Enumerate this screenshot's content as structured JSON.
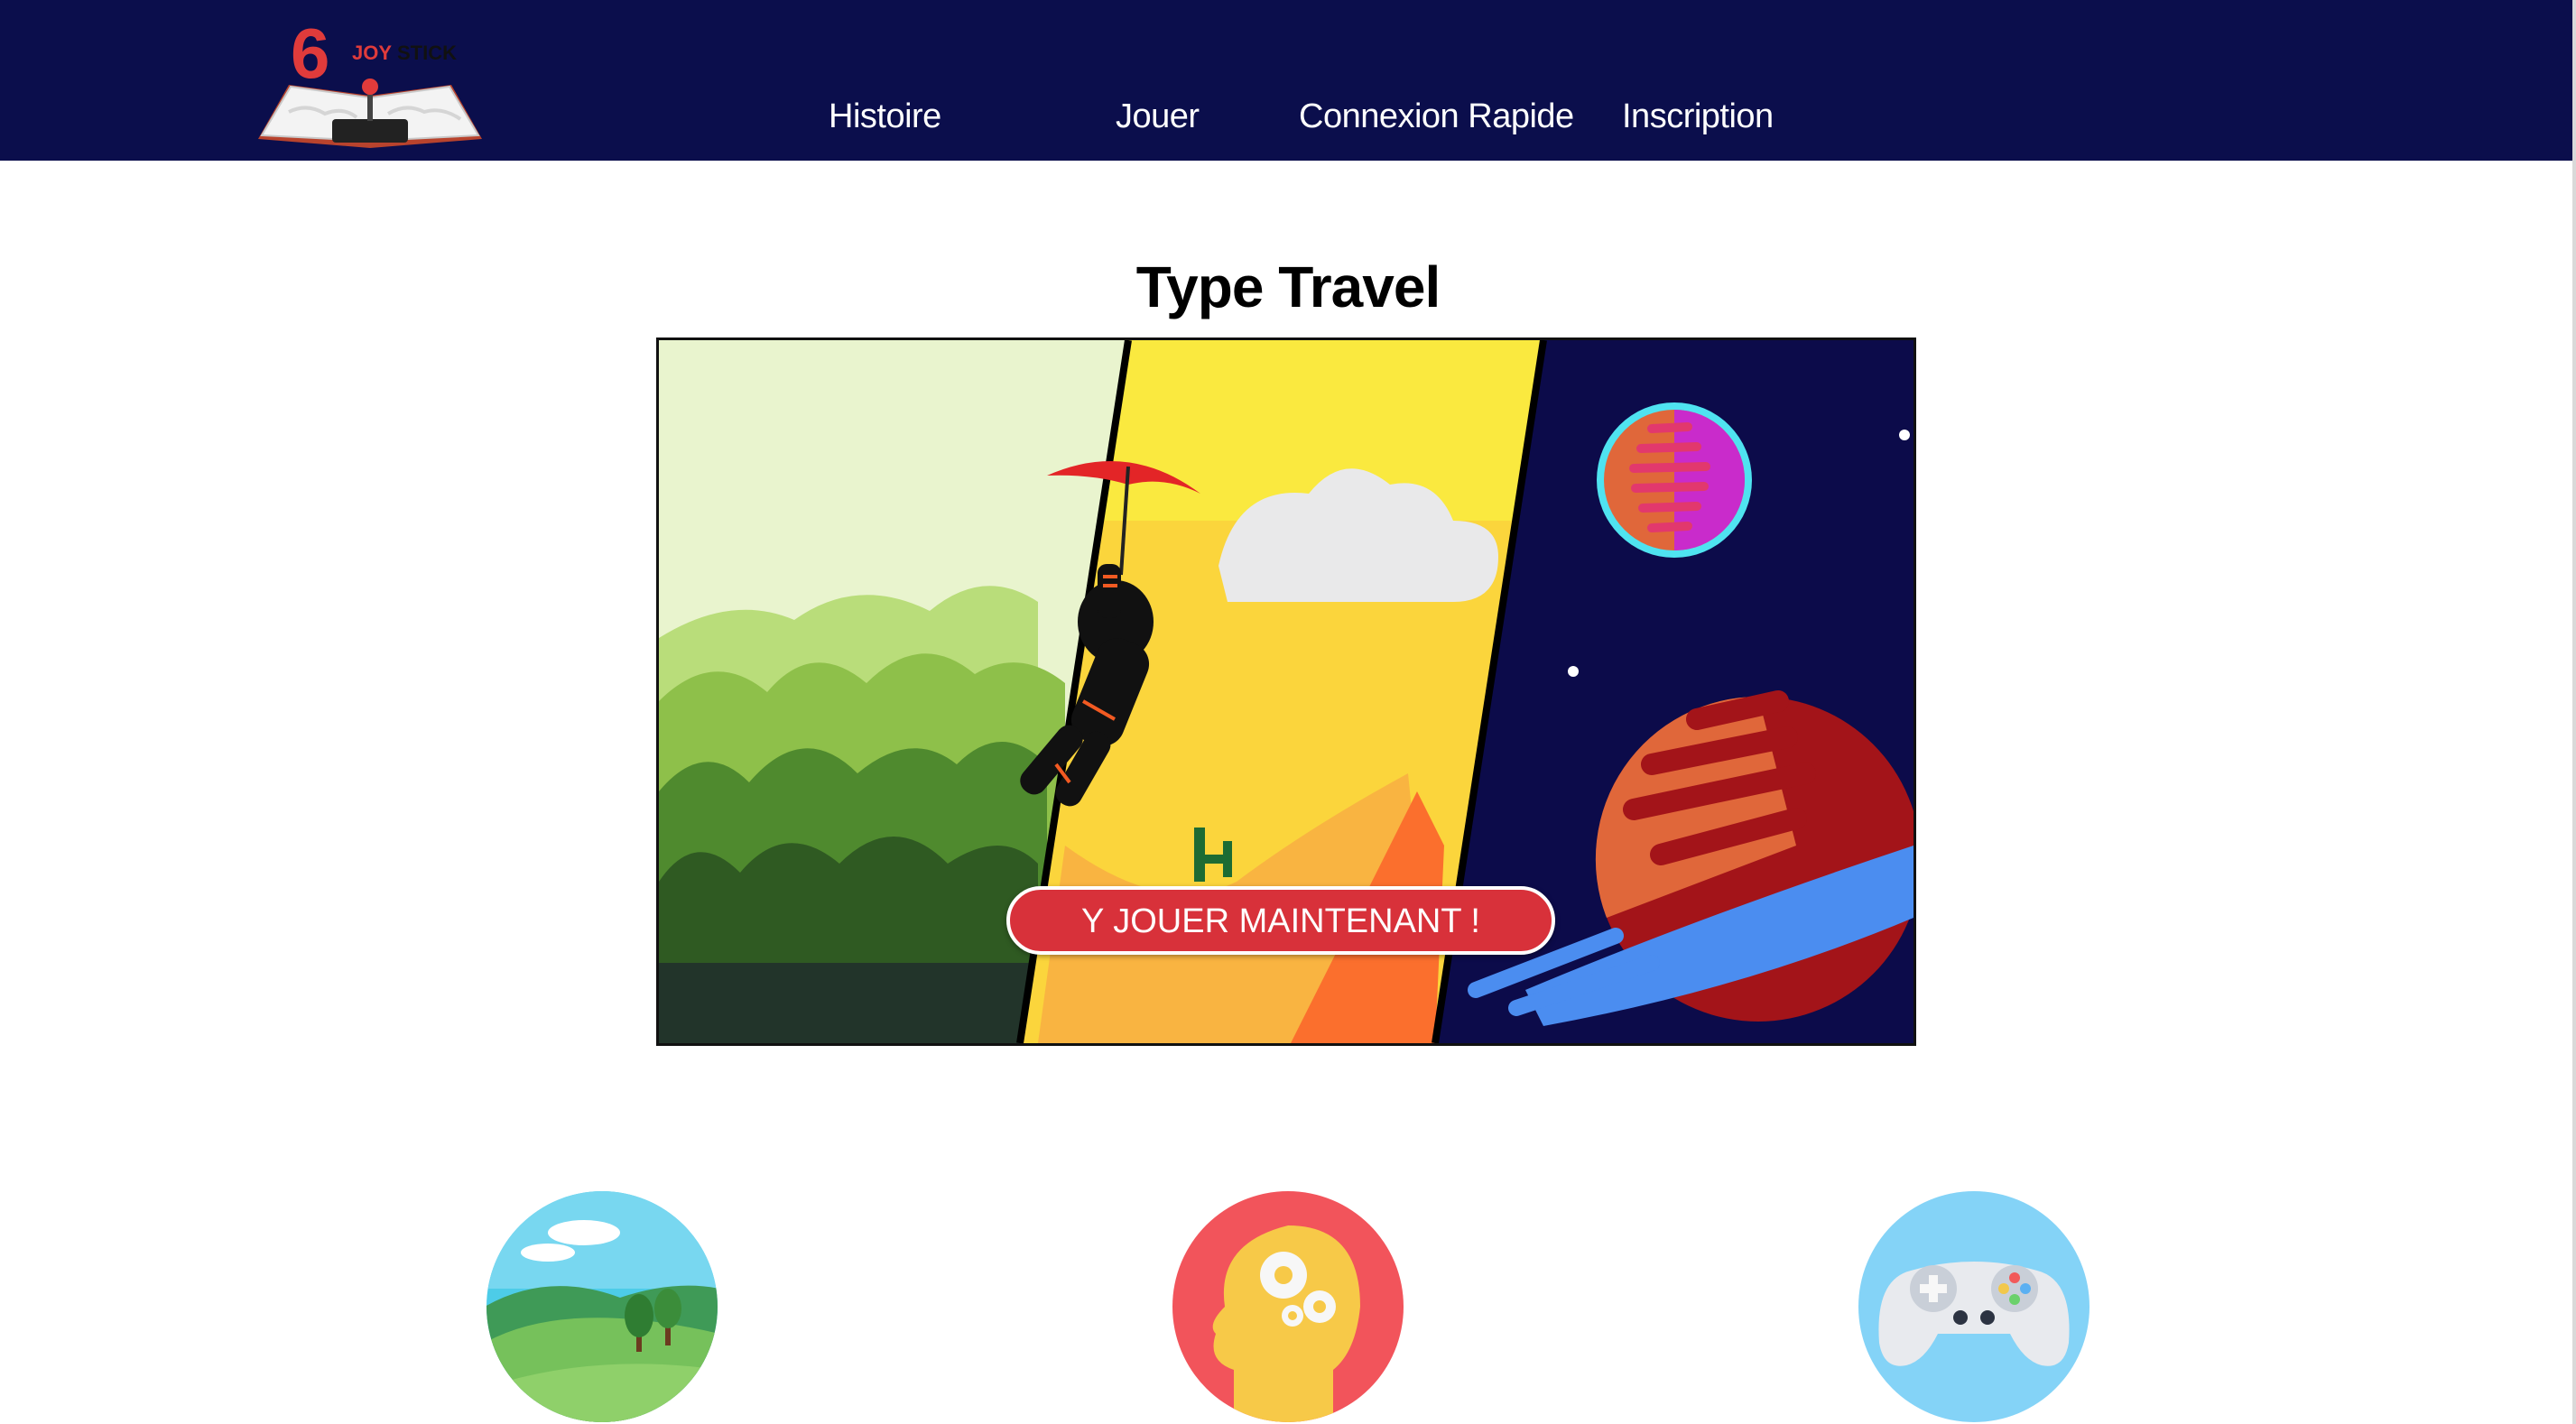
{
  "header": {
    "logo": {
      "number": "6",
      "text_red": "JOY",
      "text_dark": "STICK"
    },
    "nav": [
      {
        "label": "Histoire"
      },
      {
        "label": "Jouer"
      },
      {
        "label": "Connexion Rapide"
      },
      {
        "label": "Inscription"
      }
    ]
  },
  "main": {
    "title": "Type Travel",
    "cta_label": "Y JOUER MAINTENANT !"
  },
  "features": [
    {
      "icon": "landscape-icon"
    },
    {
      "icon": "brain-gears-icon"
    },
    {
      "icon": "gamepad-icon"
    }
  ],
  "colors": {
    "header_bg": "#0b0e4c",
    "cta": "#d8313a",
    "space_bg": "#0c0b4a"
  }
}
